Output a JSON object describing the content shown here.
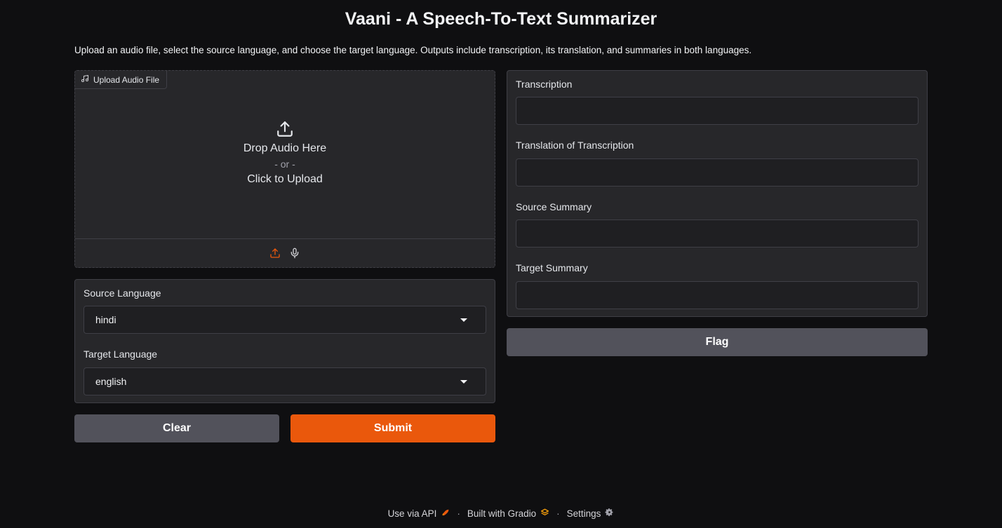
{
  "page": {
    "title": "Vaani - A Speech-To-Text Summarizer",
    "description": "Upload an audio file, select the source language, and choose the target language. Outputs include transcription, its translation, and summaries in both languages."
  },
  "audio_input": {
    "label": "Upload Audio File",
    "label_icon": "music-note-icon",
    "drop_text": "Drop Audio Here",
    "or_text": "- or -",
    "click_text": "Click to Upload",
    "sources": [
      {
        "name": "upload",
        "icon": "upload-icon",
        "active": true
      },
      {
        "name": "microphone",
        "icon": "microphone-icon",
        "active": false
      }
    ]
  },
  "languages": {
    "source_label": "Source Language",
    "source_value": "hindi",
    "target_label": "Target Language",
    "target_value": "english"
  },
  "actions": {
    "clear_label": "Clear",
    "submit_label": "Submit",
    "flag_label": "Flag"
  },
  "outputs": {
    "transcription_label": "Transcription",
    "transcription_value": "",
    "translation_label": "Translation of Transcription",
    "translation_value": "",
    "source_summary_label": "Source Summary",
    "source_summary_value": "",
    "target_summary_label": "Target Summary",
    "target_summary_value": ""
  },
  "footer": {
    "api_label": "Use via API",
    "gradio_label": "Built with Gradio",
    "settings_label": "Settings",
    "separator": "·"
  },
  "colors": {
    "background": "#0f0f11",
    "panel": "#27272a",
    "accent": "#ea580c",
    "secondary_button": "#52525b"
  }
}
